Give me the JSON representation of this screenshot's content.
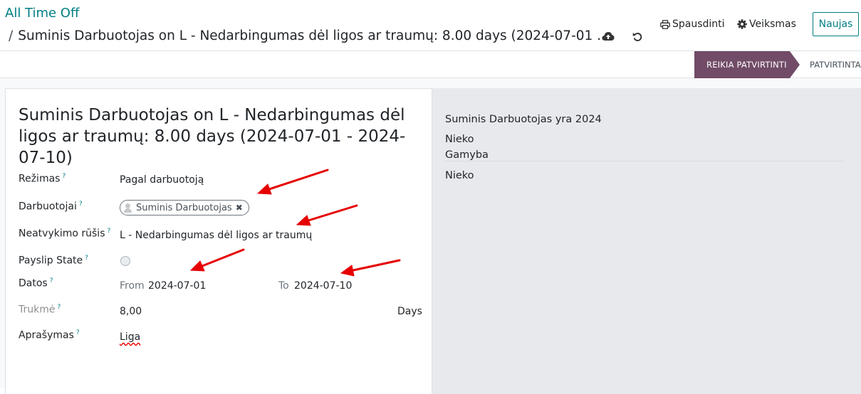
{
  "breadcrumb": {
    "root": "All Time Off",
    "separator": "/",
    "current": "Suminis Darbuotojas on L - Nedarbingumas dėl ligos ar traumų: 8.00 days (2024-07-01 ..."
  },
  "toolbar": {
    "print_label": "Spausdinti",
    "action_label": "Veiksmas",
    "new_label": "Naujas"
  },
  "statusbar": {
    "active_stage": "REIKIA PATVIRTINTI",
    "next_stage": "PATVIRTINTA"
  },
  "form": {
    "title": "Suminis Darbuotojas on L - Nedarbingumas dėl ligos ar traumų: 8.00 days (2024-07-01 - 2024-07-10)",
    "help_mark": "?",
    "mode_label": "Režimas",
    "mode_value": "Pagal darbuotoją",
    "employees_label": "Darbuotojai",
    "employee_tag": "Suminis Darbuotojas",
    "leave_type_label": "Neatvykimo rūšis",
    "leave_type_value": "L - Nedarbingumas dėl ligos ar traumų",
    "payslip_state_label": "Payslip State",
    "dates_label": "Datos",
    "from_label": "From",
    "from_value": "2024-07-01",
    "to_label": "To",
    "to_value": "2024-07-10",
    "duration_label": "Trukmė",
    "duration_value": "8,00",
    "duration_unit": "Days",
    "description_label": "Aprašymas",
    "description_value": "Liga"
  },
  "side_panel": {
    "line1": "Suminis Darbuotojas yra 2024",
    "line2": "Nieko",
    "line3": "Gamyba",
    "line4": "Nieko"
  },
  "colors": {
    "brand": "#017e84",
    "stage_active": "#714b67",
    "annotation_arrow": "#e60000"
  },
  "icons": [
    "cloud-upload-icon",
    "undo-icon",
    "print-icon",
    "gear-icon",
    "user-avatar-icon",
    "remove-tag-icon"
  ]
}
